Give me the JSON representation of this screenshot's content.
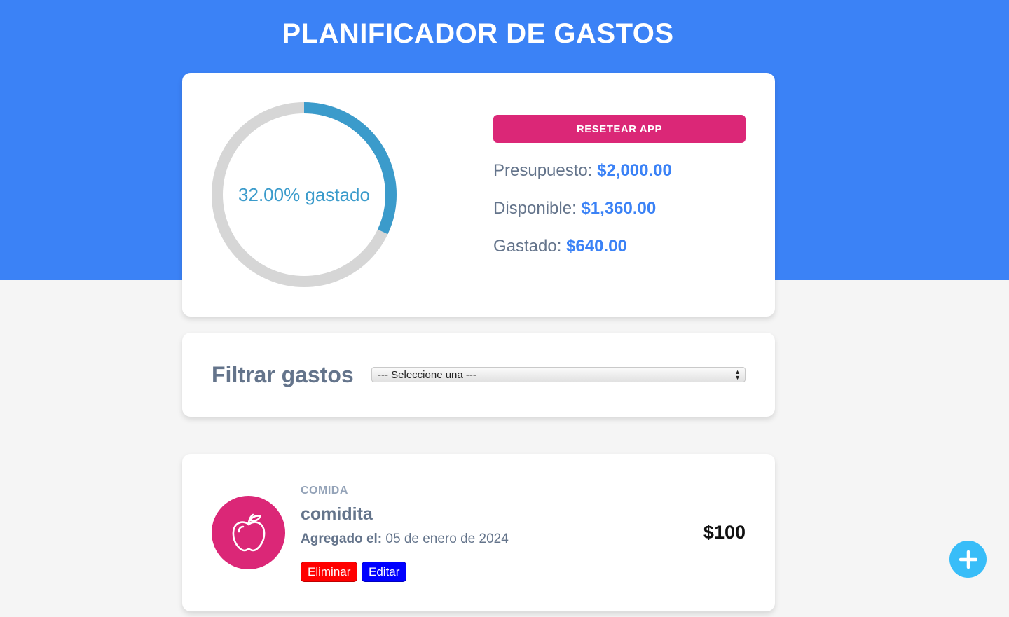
{
  "app": {
    "title": "PLANIFICADOR DE GASTOS"
  },
  "budget": {
    "reset_label": "RESETEAR APP",
    "progress_fraction": 0.32,
    "progress_label": "32.00% gastado",
    "budget_label": "Presupuesto:",
    "budget_value": "$2,000.00",
    "available_label": "Disponible:",
    "available_value": "$1,360.00",
    "spent_label": "Gastado:",
    "spent_value": "$640.00"
  },
  "filter": {
    "label": "Filtrar gastos",
    "selected": "--- Seleccione una ---"
  },
  "expenses": [
    {
      "category": "COMIDA",
      "name": "comidita",
      "date_label": "Agregado el:",
      "date": "05 de enero de 2024",
      "amount": "$100",
      "delete_label": "Eliminar",
      "edit_label": "Editar",
      "icon": "apple-icon"
    }
  ],
  "colors": {
    "header_blue": "#3b82f6",
    "accent_pink": "#db2777",
    "ring_progress": "#3b9bcb",
    "ring_track": "#d6d6d6",
    "fab_blue": "#38bdf8",
    "delete_red": "#ff0000",
    "edit_blue": "#0000ff"
  },
  "fab": {
    "icon": "plus-icon"
  }
}
